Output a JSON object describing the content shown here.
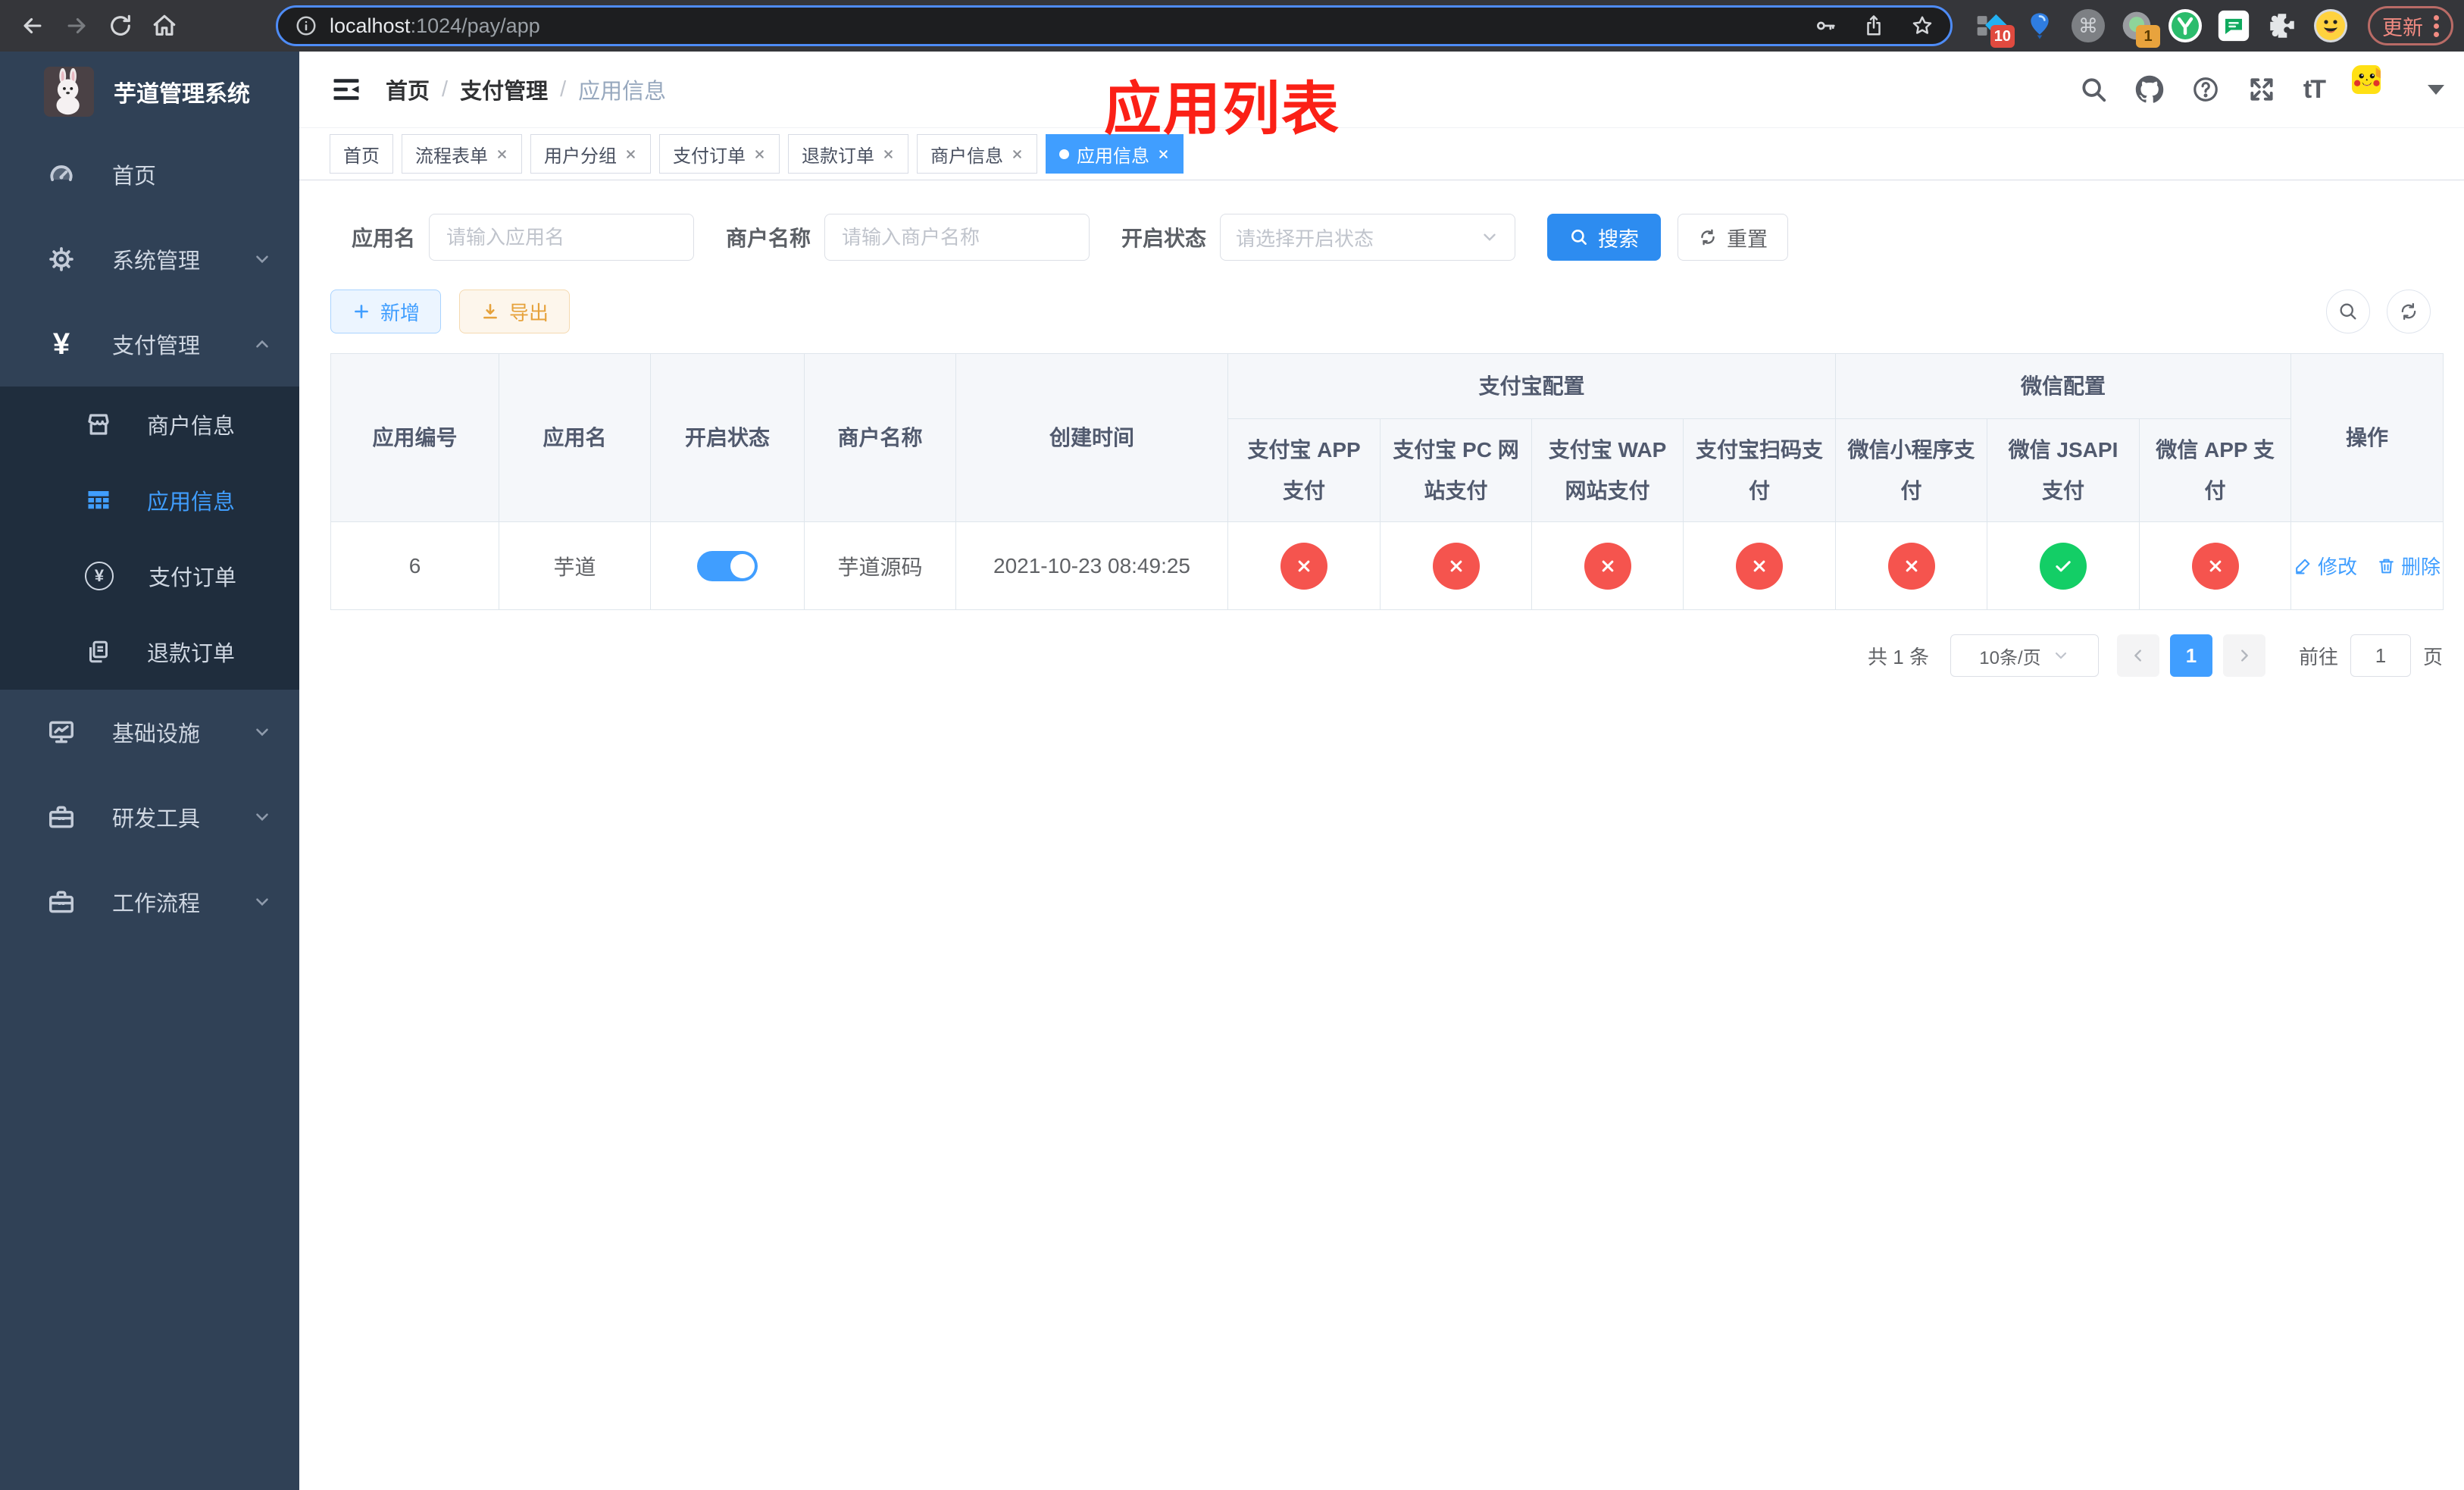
{
  "browser": {
    "url_host": "localhost",
    "url_rest": ":1024/pay/app",
    "update_label": "更新",
    "ext1_badge": "10",
    "ext4_badge": "1"
  },
  "icons": {
    "yen": "¥",
    "question": "?",
    "textsize": "tT",
    "command": "⌘"
  },
  "sidebar": {
    "app_title": "芋道管理系统",
    "home": "首页",
    "system": "系统管理",
    "payment": "支付管理",
    "merchant_info": "商户信息",
    "app_info": "应用信息",
    "pay_order": "支付订单",
    "refund_order": "退款订单",
    "infrastructure": "基础设施",
    "dev_tools": "研发工具",
    "workflow": "工作流程"
  },
  "breadcrumb": {
    "home": "首页",
    "section": "支付管理",
    "current": "应用信息",
    "sep": "/"
  },
  "annotation": "应用列表",
  "tabs": [
    {
      "label": "首页",
      "closable": false,
      "active": false
    },
    {
      "label": "流程表单",
      "closable": true,
      "active": false
    },
    {
      "label": "用户分组",
      "closable": true,
      "active": false
    },
    {
      "label": "支付订单",
      "closable": true,
      "active": false
    },
    {
      "label": "退款订单",
      "closable": true,
      "active": false
    },
    {
      "label": "商户信息",
      "closable": true,
      "active": false
    },
    {
      "label": "应用信息",
      "closable": true,
      "active": true
    }
  ],
  "filters": {
    "app_name_label": "应用名",
    "app_name_placeholder": "请输入应用名",
    "merchant_label": "商户名称",
    "merchant_placeholder": "请输入商户名称",
    "status_label": "开启状态",
    "status_placeholder": "请选择开启状态",
    "search_label": "搜索",
    "reset_label": "重置"
  },
  "toolbar": {
    "add_label": "新增",
    "export_label": "导出"
  },
  "table": {
    "columns": {
      "app_id": "应用编号",
      "app_name": "应用名",
      "status": "开启状态",
      "merchant": "商户名称",
      "create_time": "创建时间",
      "alipay_group": "支付宝配置",
      "wechat_group": "微信配置",
      "alipay_app": "支付宝 APP 支付",
      "alipay_pc": "支付宝 PC 网站支付",
      "alipay_wap": "支付宝 WAP 网站支付",
      "alipay_qr": "支付宝扫码支付",
      "wx_lite": "微信小程序支付",
      "wx_jsapi": "微信 JSAPI 支付",
      "wx_app": "微信 APP 支付",
      "actions": "操作"
    },
    "row": {
      "app_id": "6",
      "app_name": "芋道",
      "status_on": true,
      "merchant": "芋道源码",
      "create_time": "2021-10-23 08:49:25",
      "configs": [
        "disabled",
        "disabled",
        "disabled",
        "disabled",
        "disabled",
        "enabled",
        "disabled"
      ],
      "edit_label": "修改",
      "delete_label": "删除"
    }
  },
  "pagination": {
    "total": "共 1 条",
    "page_size": "10条/页",
    "current_page": "1",
    "goto_label": "前往",
    "goto_value": "1",
    "page_unit": "页"
  },
  "colors": {
    "accent_blue": "#409eff",
    "danger_red": "#f5544e",
    "success_green": "#13ce66",
    "sidebar_bg": "#304156",
    "submenu_bg": "#1f2d3d",
    "annotation_red": "#fb2016"
  }
}
